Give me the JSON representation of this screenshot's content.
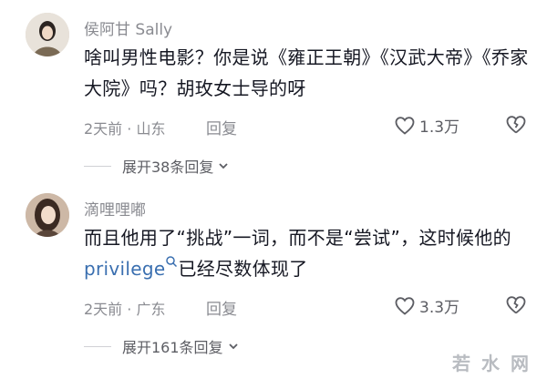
{
  "comments": [
    {
      "username": "侯阿甘 Sally",
      "text_parts": [
        "啥叫男性电影？你是说《雍正王朝》《汉武大帝》《乔家大院》吗？胡玫女士导的呀"
      ],
      "meta": "2天前 · 山东",
      "reply_label": "回复",
      "likes": "1.3万",
      "expand_label": "展开38条回复"
    },
    {
      "username": "滴哩哩嘟",
      "text_before": "而且他用了“挑战”一词，而不是“尝试”，这时候他的 ",
      "link_text": "privilege",
      "text_after": "已经尽数体现了",
      "meta": "2天前 · 广东",
      "reply_label": "回复",
      "likes": "3.3万",
      "expand_label": "展开161条回复"
    }
  ],
  "watermark": "若水网",
  "icons": {
    "like": "heart-outline-icon",
    "dislike": "broken-heart-icon",
    "search": "search-icon",
    "chevron": "chevron-down-icon"
  }
}
